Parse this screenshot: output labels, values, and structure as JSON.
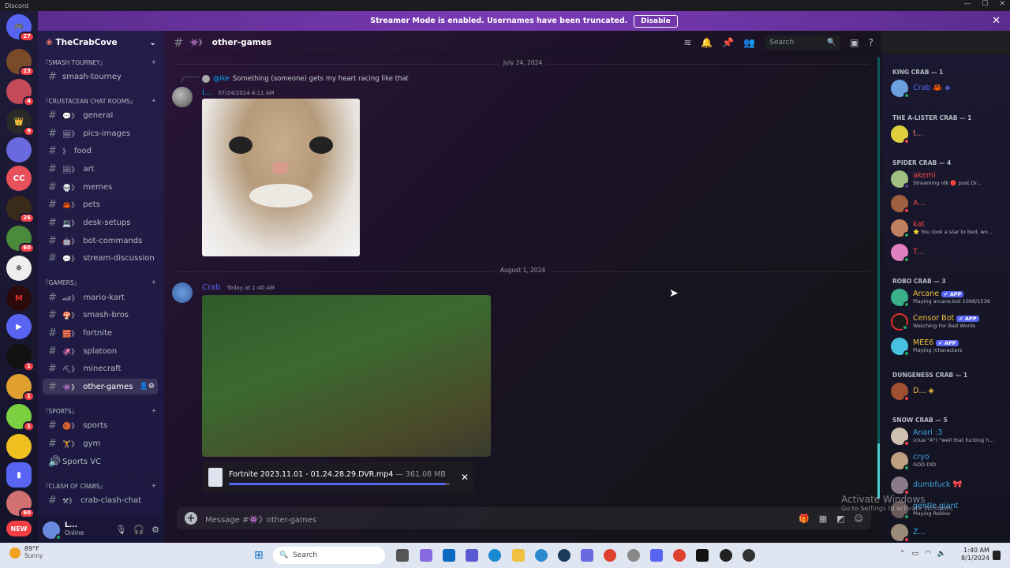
{
  "window": {
    "title": "Discord"
  },
  "banner": {
    "text": "Streamer Mode is enabled. Usernames have been truncated.",
    "button": "Disable"
  },
  "servers": [
    {
      "badge": "27"
    },
    {
      "badge": "23"
    },
    {
      "badge": "4"
    },
    {
      "badge": "9"
    },
    {
      "badge": ""
    },
    {
      "badge": ""
    },
    {
      "badge": "26"
    },
    {
      "badge": "60"
    },
    {
      "badge": ""
    },
    {
      "badge": ""
    },
    {
      "badge": ""
    },
    {
      "badge": "1"
    },
    {
      "badge": "1"
    },
    {
      "badge": "1"
    },
    {
      "badge": ""
    },
    {
      "badge": ""
    },
    {
      "badge": "60"
    }
  ],
  "new_label": "NEW",
  "sidebar": {
    "server_name": "TheCrabCove",
    "categories": [
      {
        "name": "『SMASH TOURNEY』"
      },
      {
        "name": "『CRUSTACEAN CHAT ROOMS』"
      },
      {
        "name": "『GAMERS』"
      },
      {
        "name": "『SPORTS』"
      },
      {
        "name": "『CLASH OF CRABS』"
      }
    ],
    "channels": [
      {
        "emoji": "",
        "name": "smash-tourney"
      },
      {
        "emoji": "💬》",
        "name": "general"
      },
      {
        "emoji": "🖼》",
        "name": "pics-images"
      },
      {
        "emoji": "》",
        "name": "food"
      },
      {
        "emoji": "🖼》",
        "name": "art"
      },
      {
        "emoji": "💀》",
        "name": "memes"
      },
      {
        "emoji": "🦀》",
        "name": "pets"
      },
      {
        "emoji": "💻》",
        "name": "desk-setups"
      },
      {
        "emoji": "🤖》",
        "name": "bot-commands"
      },
      {
        "emoji": "💬》",
        "name": "stream-discussion"
      },
      {
        "emoji": "🏎》",
        "name": "mario-kart"
      },
      {
        "emoji": "🍄》",
        "name": "smash-bros"
      },
      {
        "emoji": "🧱》",
        "name": "fortnite"
      },
      {
        "emoji": "🦑》",
        "name": "splatoon"
      },
      {
        "emoji": "⛏》",
        "name": "minecraft"
      },
      {
        "emoji": "👾》",
        "name": "other-games"
      },
      {
        "emoji": "🏀》",
        "name": "sports"
      },
      {
        "emoji": "🏋》",
        "name": "gym"
      },
      {
        "emoji": "",
        "name": "Sports VC"
      },
      {
        "emoji": "⚒》",
        "name": "crab-clash-chat"
      }
    ],
    "user": {
      "name": "L...",
      "status": "Online"
    }
  },
  "channel_header": {
    "name": "other-games",
    "emoji": "👾》",
    "search_placeholder": "Search"
  },
  "messages": {
    "divider1": "July 24, 2024",
    "reply_mention": "@ike",
    "reply_text": "Something (someone) gets my heart racing like that",
    "msg1_author": "i...",
    "msg1_time": "07/24/2024 4:11 AM",
    "divider2": "August 1, 2024",
    "msg2_author": "Crab",
    "msg2_time": "Today at 1:40 AM",
    "upload_name": "Fortnite 2023.11.01 - 01.24.28.29.DVR.mp4",
    "upload_size": "— 361.08 MB",
    "upload_progress": 0.98
  },
  "composer": {
    "placeholder": "Message #👾》other-games"
  },
  "members": {
    "groups": [
      {
        "name": "KING CRAB — 1"
      },
      {
        "name": "THE A-LISTER CRAB — 1"
      },
      {
        "name": "SPIDER CRAB — 4"
      },
      {
        "name": "ROBO CRAB — 3"
      },
      {
        "name": "DUNGENESS CRAB — 1"
      },
      {
        "name": "SNOW CRAB — 5"
      }
    ],
    "list": [
      {
        "name": "Crab 🦀 ◈",
        "status": "",
        "color": "#5865f2"
      },
      {
        "name": "t...",
        "status": "",
        "color": "#f47b67"
      },
      {
        "name": "akemi",
        "status": "Streaming idk 🔴 post Dr...",
        "color": "#f04747"
      },
      {
        "name": "A...",
        "status": "",
        "color": "#f04747"
      },
      {
        "name": "kat",
        "status": "⭐ You took a star to bed, wo...",
        "color": "#f04747"
      },
      {
        "name": "T...",
        "status": "",
        "color": "#f04747"
      },
      {
        "name": "Arcane",
        "status": "Playing arcane.bot 1098/1536",
        "color": "#f0c040",
        "app": "✔ APP"
      },
      {
        "name": "Censor Bot",
        "status": "Watching For Bad Words",
        "color": "#f0c040",
        "app": "✔ APP"
      },
      {
        "name": "MEE6",
        "status": "Playing /characters",
        "color": "#f0c040",
        "app": "✔ APP"
      },
      {
        "name": "D... ◈",
        "status": "",
        "color": "#f0c040"
      },
      {
        "name": "Anari :3",
        "status": "(clue \"A\") \"well that fucking h...",
        "color": "#3fa3e0"
      },
      {
        "name": "cryo",
        "status": "GOD DID",
        "color": "#3fa3e0"
      },
      {
        "name": "dumbfuck 🎀",
        "status": "",
        "color": "#3fa3e0"
      },
      {
        "name": "gentle giant",
        "status": "Playing Roblox",
        "color": "#3fa3e0"
      },
      {
        "name": "Z...",
        "status": "",
        "color": "#3fa3e0"
      }
    ]
  },
  "watermark": {
    "line1": "Activate Windows",
    "line2": "Go to Settings to activate Windows."
  },
  "taskbar": {
    "weather_temp": "89°F",
    "weather_desc": "Sunny",
    "search": "Search",
    "time": "1:40 AM",
    "date": "8/1/2024"
  }
}
